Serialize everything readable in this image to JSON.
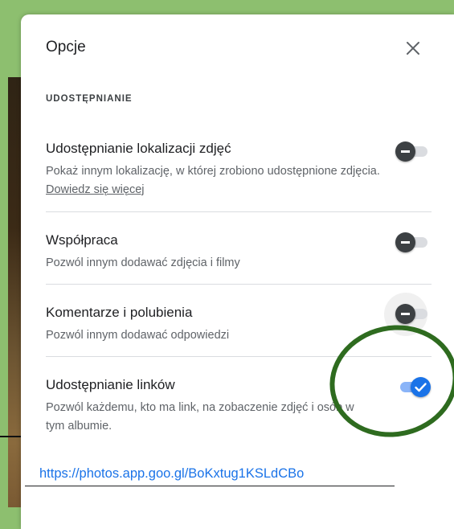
{
  "dialog": {
    "title": "Opcje",
    "close_icon": "close-icon"
  },
  "section": {
    "label": "UDOSTĘPNIANIE"
  },
  "settings": [
    {
      "title": "Udostępnianie lokalizacji zdjęć",
      "description": "Pokaż innym lokalizację, w której zrobiono udostępnione zdjęcia.",
      "learn_more": "Dowiedz się więcej",
      "enabled": false
    },
    {
      "title": "Współpraca",
      "description": "Pozwól innym dodawać zdjęcia i filmy",
      "enabled": false
    },
    {
      "title": "Komentarze i polubienia",
      "description": "Pozwól innym dodawać odpowiedzi",
      "enabled": false
    },
    {
      "title": "Udostępnianie linków",
      "description": "Pozwól każdemu, kto ma link, na zobaczenie zdjęć i osób w tym albumie.",
      "enabled": true
    }
  ],
  "share_link": "https://photos.app.goo.gl/BoKxtug1KSLdCBo",
  "colors": {
    "accent": "#1a73e8",
    "annotation": "#2e6b1f"
  }
}
